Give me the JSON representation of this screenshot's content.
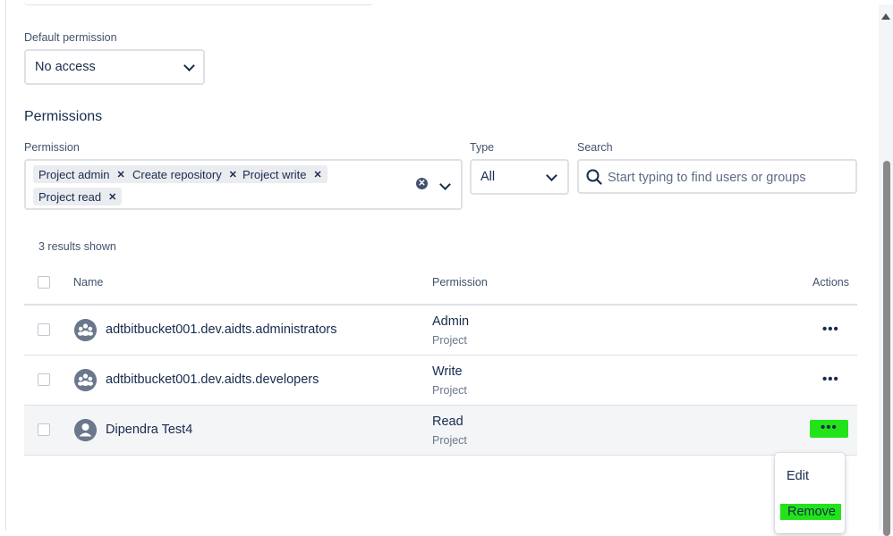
{
  "default_permission": {
    "label": "Default permission",
    "value": "No access"
  },
  "permissions": {
    "heading": "Permissions",
    "filter_label": "Permission",
    "chips": [
      "Project admin",
      "Create repository",
      "Project write",
      "Project read"
    ],
    "type_label": "Type",
    "type_value": "All",
    "search_label": "Search",
    "search_placeholder": "Start typing to find users or groups"
  },
  "table": {
    "results_text": "3 results shown",
    "columns": {
      "name": "Name",
      "permission": "Permission",
      "actions": "Actions"
    },
    "rows": [
      {
        "name": "adtbitbucket001.dev.aidts.administrators",
        "permission": "Admin",
        "scope": "Project",
        "type": "group-icon"
      },
      {
        "name": "adtbitbucket001.dev.aidts.developers",
        "permission": "Write",
        "scope": "Project",
        "type": "group-icon"
      },
      {
        "name": "Dipendra Test4",
        "permission": "Read",
        "scope": "Project",
        "type": "user-icon"
      }
    ],
    "actions_glyph": "•••"
  },
  "actions_menu": {
    "items": [
      "Edit",
      "Remove"
    ]
  },
  "colors": {
    "highlight": "#22e31a",
    "text": "#172b4d",
    "subtle": "#6b778c"
  }
}
